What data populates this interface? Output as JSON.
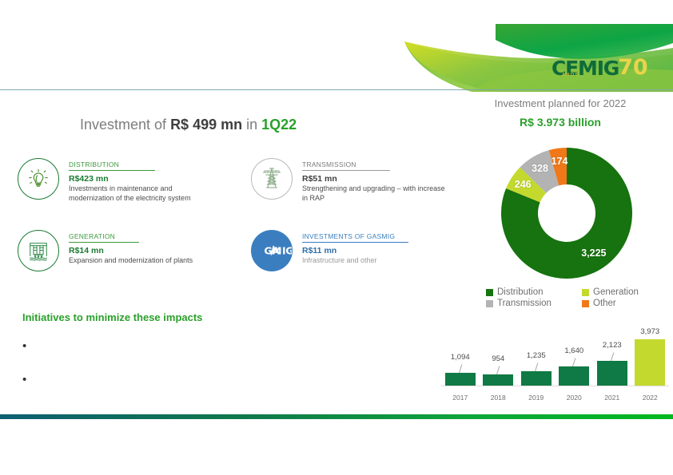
{
  "brand": {
    "logo_name": "CEMIG",
    "logo_anniversary": "70",
    "logo_anniversary_sub": "ANOS",
    "green": "#2aa02a",
    "dark_green": "#1a7a32",
    "donut_green": "#16730f",
    "yellow_green": "#c4d92e",
    "grey": "#b3b3b3",
    "orange": "#f07818",
    "blue": "#3a7ebf"
  },
  "left": {
    "title": {
      "part1": "Investment of ",
      "amount": "R$ 499 mn",
      "part2": " in ",
      "period": "1Q22"
    },
    "cards": [
      {
        "icon": "lightbulb-icon",
        "label": "DISTRIBUTION",
        "amount": "R$423 mn",
        "desc": "Investments in maintenance and modernization of the electricity system"
      },
      {
        "icon": "transmission-tower-icon",
        "label": "TRANSMISSION",
        "amount": "R$51 mn",
        "desc": "Strengthening and upgrading – with increase in RAP"
      },
      {
        "icon": "hydro-plant-icon",
        "label": "GENERATION",
        "amount": "R$14 mn",
        "desc": "Expansion and modernization of plants"
      },
      {
        "icon": "gasmig-logo-icon",
        "label": "INVESTMENTS OF GASMIG",
        "amount": "R$11 mn",
        "desc": "Infrastructure and other"
      }
    ],
    "initiatives_heading": "Initiatives to minimize these impacts",
    "bullets": [
      "",
      ""
    ]
  },
  "right": {
    "donut_title": "Investment planned for 2022",
    "donut_subtitle": "R$ 3.973 billion"
  },
  "chart_data": [
    {
      "type": "pie",
      "title": "Investment planned for 2022",
      "subtitle": "R$ 3.973 billion",
      "donut": true,
      "unit": "R$ mn",
      "total": 3973,
      "legend_position": "bottom",
      "categories": [
        "Distribution",
        "Generation",
        "Transmission",
        "Other"
      ],
      "values": [
        3225,
        246,
        328,
        174
      ],
      "labels": [
        "3,225",
        "246",
        "328",
        "174"
      ],
      "colors": [
        "#16730f",
        "#c4d92e",
        "#b3b3b3",
        "#f07818"
      ]
    },
    {
      "type": "bar",
      "title": "",
      "xlabel": "",
      "ylabel": "",
      "unit": "R$ mn",
      "grid": false,
      "categories": [
        "2017",
        "2018",
        "2019",
        "2020",
        "2021",
        "2022"
      ],
      "values": [
        1094,
        954,
        1235,
        1640,
        2123,
        3973
      ],
      "labels": [
        "1,094",
        "954",
        "1,235",
        "1,640",
        "2,123",
        "3,973"
      ],
      "colors": [
        "#0f7a45",
        "#0f7a45",
        "#0f7a45",
        "#0f7a45",
        "#0f7a45",
        "#c4d92e"
      ],
      "ylim": [
        0,
        3973
      ]
    }
  ],
  "legend": [
    {
      "label": "Distribution",
      "color": "#16730f"
    },
    {
      "label": "Generation",
      "color": "#c4d92e"
    },
    {
      "label": "Transmission",
      "color": "#b3b3b3"
    },
    {
      "label": "Other",
      "color": "#f07818"
    }
  ]
}
